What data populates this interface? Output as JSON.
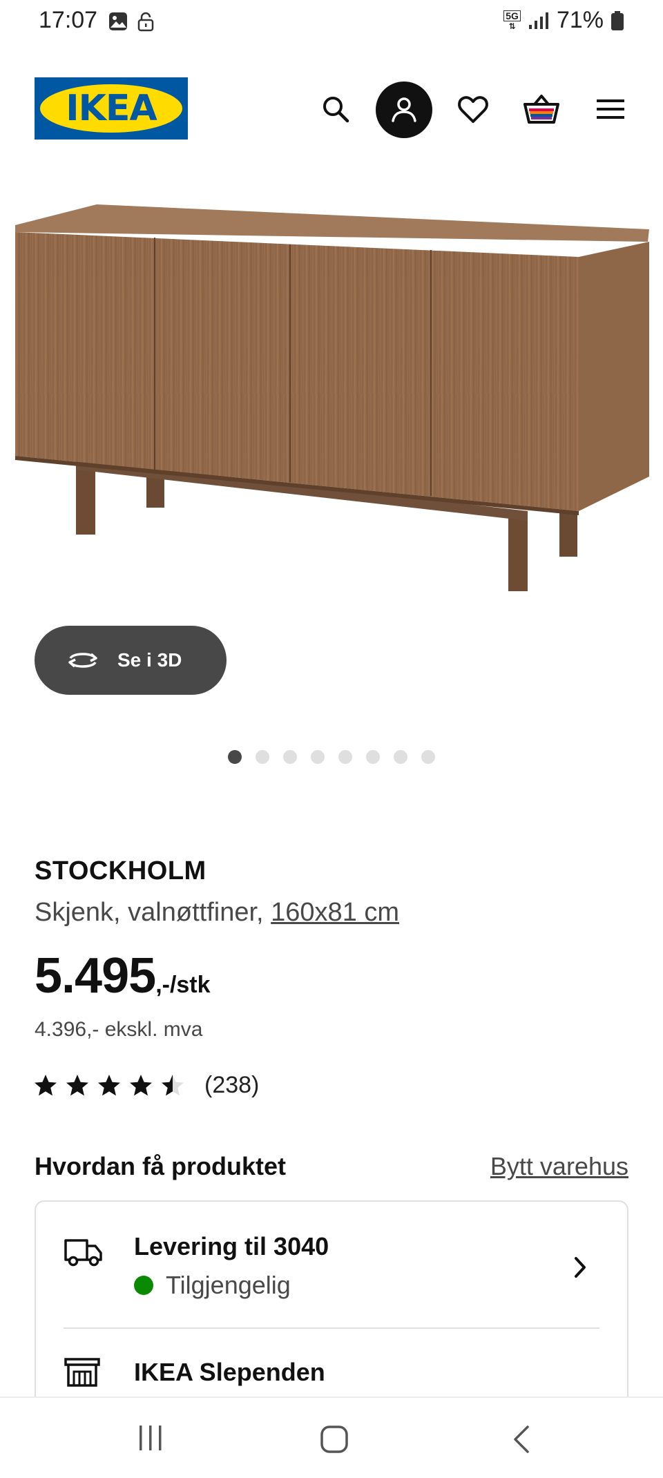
{
  "status_bar": {
    "time": "17:07",
    "network": "5G",
    "battery": "71%"
  },
  "header": {
    "logo_text": "IKEA",
    "brand_colors": {
      "blue": "#0058a3",
      "yellow": "#ffdb00"
    },
    "icons": [
      "search-icon",
      "account-icon",
      "heart-icon",
      "basket-icon",
      "menu-icon"
    ]
  },
  "gallery": {
    "view_3d_label": "Se i 3D",
    "total_images": 8,
    "active_index": 0
  },
  "product": {
    "name": "STOCKHOLM",
    "description": "Skjenk, valnøttfiner, ",
    "size": "160x81 cm",
    "price": "5.495",
    "price_suffix": ",-/stk",
    "price_ex_vat": "4.396,- ekskl. mva",
    "rating": 4.5,
    "rating_count": "(238)"
  },
  "delivery": {
    "heading": "Hvordan få produktet",
    "change_store": "Bytt varehus",
    "options": [
      {
        "title": "Levering til 3040",
        "status": "Tilgjengelig",
        "status_color": "#0a8a00"
      },
      {
        "title": "IKEA Slependen"
      }
    ]
  }
}
